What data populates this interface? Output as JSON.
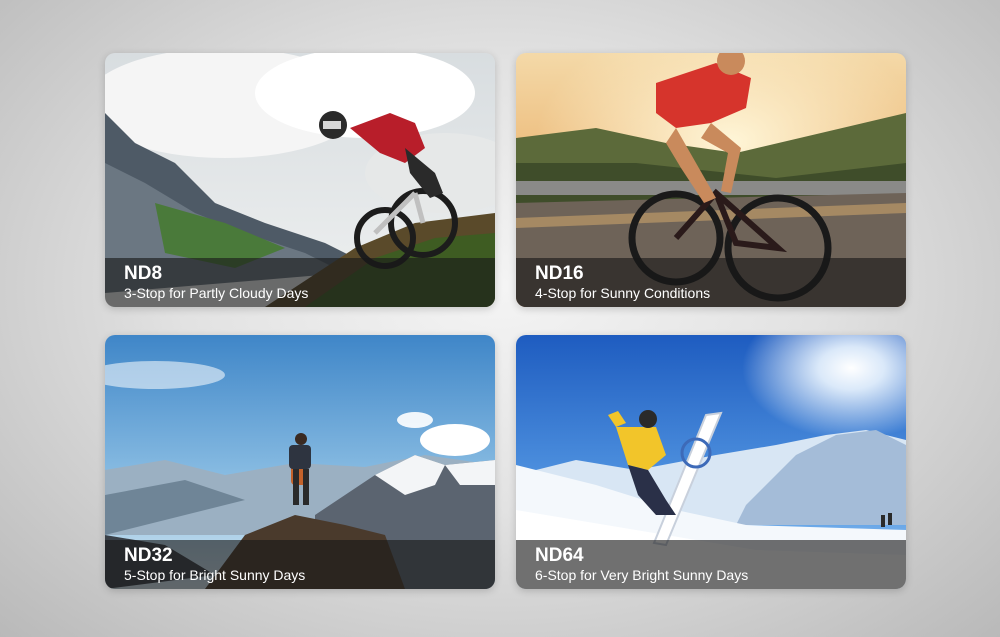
{
  "cards": [
    {
      "title": "ND8",
      "subtitle": "3-Stop for Partly Cloudy Days",
      "image": "mountain-bike-downhill-photo"
    },
    {
      "title": "ND16",
      "subtitle": "4-Stop for Sunny Conditions",
      "image": "road-cyclist-sunset-photo"
    },
    {
      "title": "ND32",
      "subtitle": "5-Stop for Bright Sunny Days",
      "image": "hiker-mountain-summit-photo"
    },
    {
      "title": "ND64",
      "subtitle": "6-Stop for Very Bright Sunny Days",
      "image": "snowboarder-jump-photo"
    }
  ],
  "colors": {
    "caption_overlay": "#191919",
    "caption_text": "#ffffff"
  }
}
